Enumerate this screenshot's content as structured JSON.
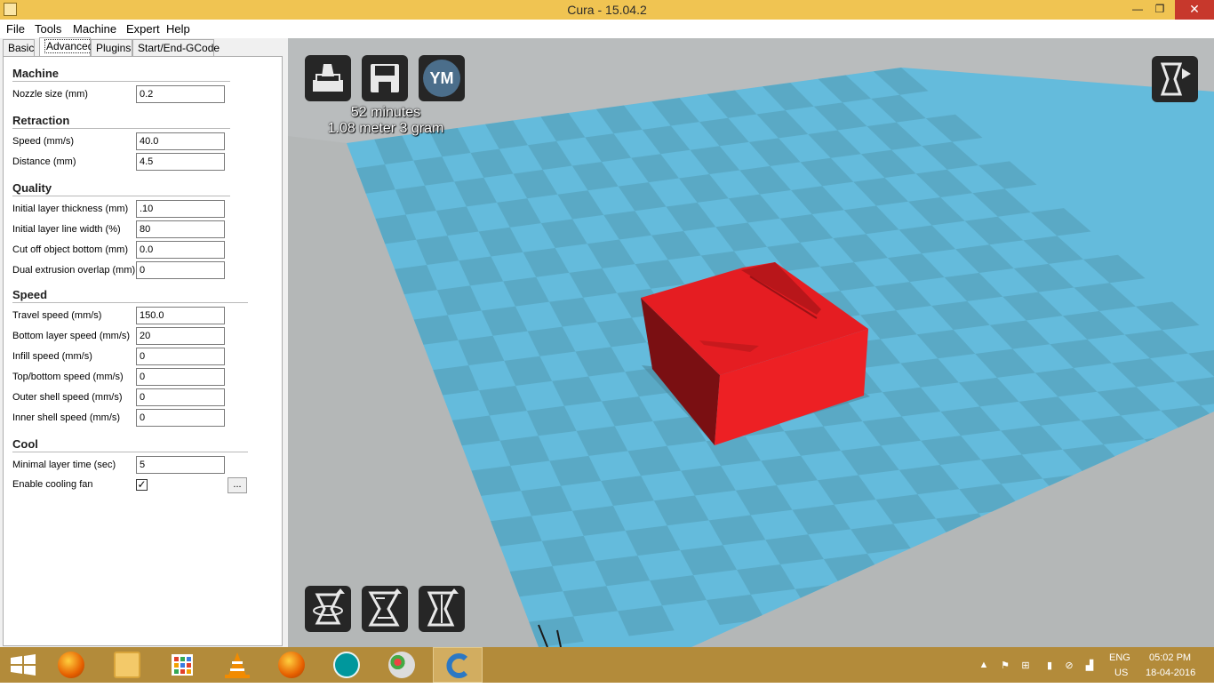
{
  "window": {
    "title": "Cura - 15.04.2",
    "min_glyph": "—",
    "max_glyph": "❐",
    "close_glyph": "✕"
  },
  "menu": [
    "File",
    "Tools",
    "Machine",
    "Expert",
    "Help"
  ],
  "tabs": [
    "Basic",
    "Advanced",
    "Plugins",
    "Start/End-GCode"
  ],
  "sections": {
    "machine": "Machine",
    "retraction": "Retraction",
    "quality": "Quality",
    "speed": "Speed",
    "cool": "Cool"
  },
  "fields": {
    "nozzle_size": {
      "label": "Nozzle size (mm)",
      "value": "0.2"
    },
    "retraction_speed": {
      "label": "Speed (mm/s)",
      "value": "40.0"
    },
    "retraction_distance": {
      "label": "Distance (mm)",
      "value": "4.5"
    },
    "initial_layer_thickness": {
      "label": "Initial layer thickness (mm)",
      "value": ".10"
    },
    "initial_layer_line_width": {
      "label": "Initial layer line width (%)",
      "value": "80"
    },
    "cut_off_object_bottom": {
      "label": "Cut off object bottom (mm)",
      "value": "0.0"
    },
    "dual_extrusion_overlap": {
      "label": "Dual extrusion overlap (mm)",
      "value": "0"
    },
    "travel_speed": {
      "label": "Travel speed (mm/s)",
      "value": "150.0"
    },
    "bottom_layer_speed": {
      "label": "Bottom layer speed (mm/s)",
      "value": "20"
    },
    "infill_speed": {
      "label": "Infill speed (mm/s)",
      "value": "0"
    },
    "top_bottom_speed": {
      "label": "Top/bottom speed (mm/s)",
      "value": "0"
    },
    "outer_shell_speed": {
      "label": "Outer shell speed (mm/s)",
      "value": "0"
    },
    "inner_shell_speed": {
      "label": "Inner shell speed (mm/s)",
      "value": "0"
    },
    "minimal_layer_time": {
      "label": "Minimal layer time (sec)",
      "value": "5"
    },
    "enable_cooling_fan": {
      "label": "Enable cooling fan",
      "checked": true,
      "check_glyph": "✓",
      "more_label": "..."
    }
  },
  "viewport": {
    "print_time": "52 minutes",
    "print_material": "1.08 meter 3 gram",
    "ym_label": "YM",
    "platform_light": "#64bbdc",
    "platform_dark": "#5aa9c5",
    "model_color": "#ed2024"
  },
  "taskbar": {
    "apps": [
      "windows-start",
      "firefox",
      "file-explorer",
      "control-panel",
      "vlc",
      "firefox-2",
      "arduino",
      "paint",
      "cura"
    ],
    "language": "ENG",
    "region": "US",
    "time": "05:02 PM",
    "date": "18-04-2016"
  }
}
